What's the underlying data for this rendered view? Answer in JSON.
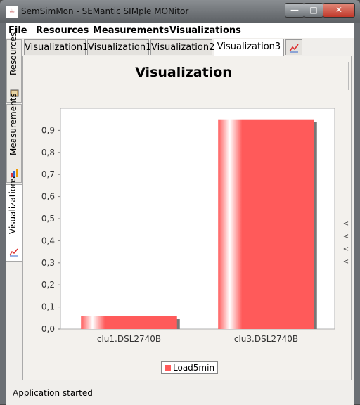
{
  "window": {
    "title": "SemSimMon - SEMantic SIMple MONitor",
    "min": "—",
    "max": "□",
    "close": "✕"
  },
  "menu": [
    "File",
    "Resources",
    "Measurements",
    "Visualizations"
  ],
  "side_tabs": [
    "Resources",
    "Measurements",
    "Visualizations"
  ],
  "tabs": [
    "Visualization1",
    "Visualization1",
    "Visualization2",
    "Visualization3"
  ],
  "tab_close": "✖",
  "status": "Application started",
  "arrows": [
    "<",
    "<",
    "<",
    "<"
  ],
  "colors": {
    "bar": "#ff5a5a",
    "bar_shadow": "#777777"
  },
  "chart_data": {
    "type": "bar",
    "title": "Visualization",
    "categories": [
      "clu1.DSL2740B",
      "clu3.DSL2740B"
    ],
    "series": [
      {
        "name": "Load5min",
        "values": [
          0.06,
          0.95
        ]
      }
    ],
    "ylim": [
      0,
      1.0
    ],
    "yticks": [
      "0,0",
      "0,1",
      "0,2",
      "0,3",
      "0,4",
      "0,5",
      "0,6",
      "0,7",
      "0,8",
      "0,9"
    ],
    "legend": "bottom"
  }
}
